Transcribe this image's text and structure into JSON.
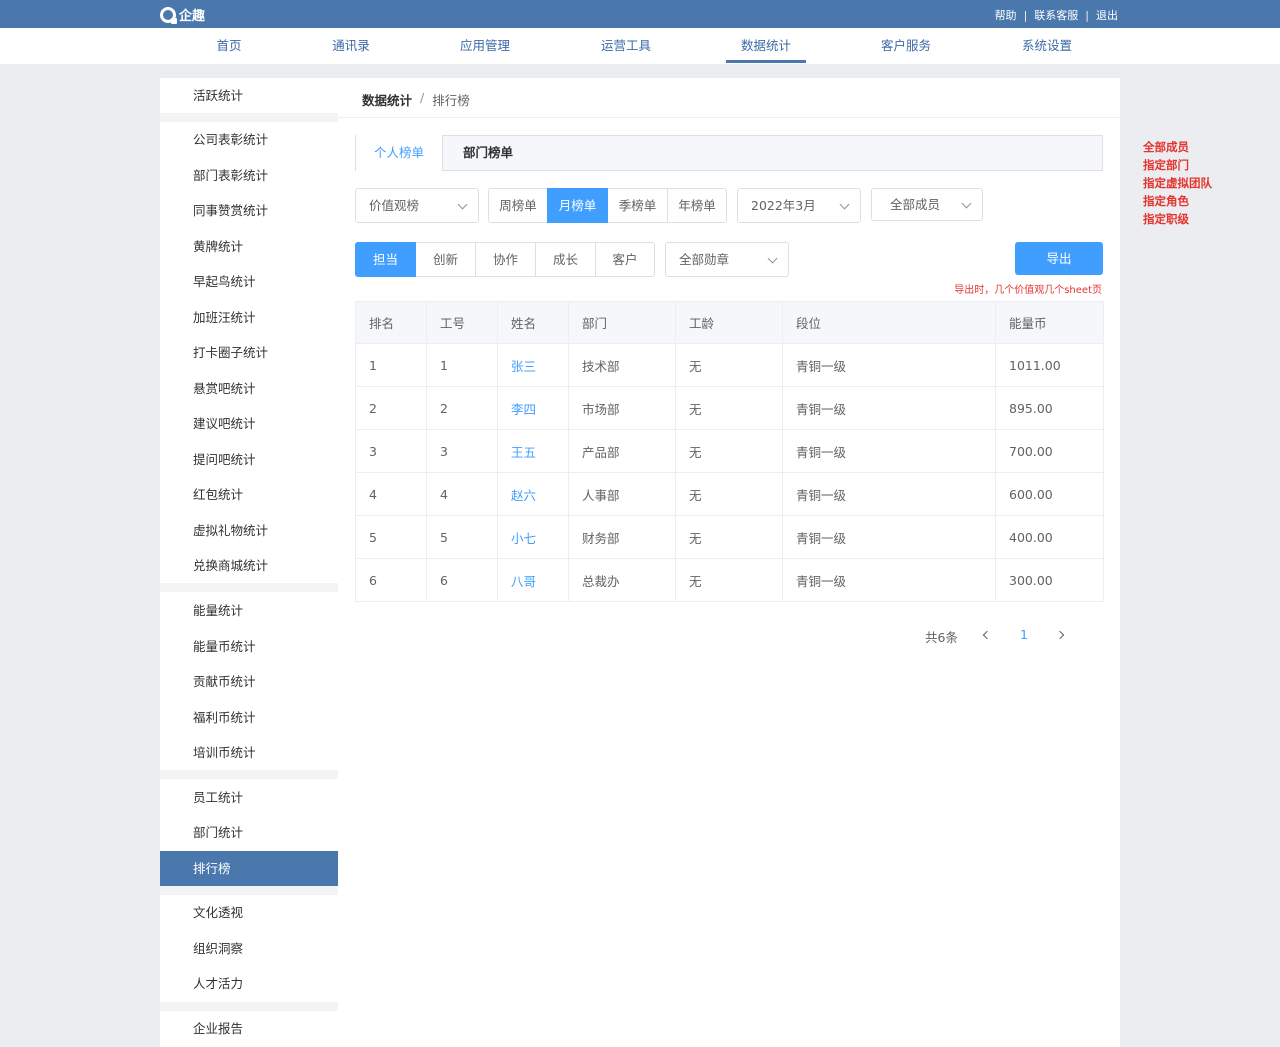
{
  "app": {
    "logo_text": "企趣"
  },
  "top_links": [
    "帮助",
    "联系客服",
    "退出"
  ],
  "main_nav": [
    "首页",
    "通讯录",
    "应用管理",
    "运营工具",
    "数据统计",
    "客户服务",
    "系统设置"
  ],
  "main_nav_active": "数据统计",
  "sidebar": {
    "groups": [
      [
        "活跃统计"
      ],
      [
        "公司表彰统计",
        "部门表彰统计",
        "同事赞赏统计",
        "黄牌统计",
        "早起鸟统计",
        "加班汪统计",
        "打卡圈子统计",
        "悬赏吧统计",
        "建议吧统计",
        "提问吧统计",
        "红包统计",
        "虚拟礼物统计",
        "兑换商城统计"
      ],
      [
        "能量统计",
        "能量币统计",
        "贡献币统计",
        "福利币统计",
        "培训币统计"
      ],
      [
        "员工统计",
        "部门统计",
        "排行榜"
      ],
      [
        "文化透视",
        "组织洞察",
        "人才活力"
      ],
      [
        "企业报告"
      ]
    ],
    "active": "排行榜"
  },
  "breadcrumb": {
    "parent": "数据统计",
    "separator": "/",
    "current": "排行榜"
  },
  "tabs": {
    "active": "个人榜单",
    "other": "部门榜单"
  },
  "filters": {
    "value_select": "价值观榜",
    "period_buttons": [
      "周榜单",
      "月榜单",
      "季榜单",
      "年榜单"
    ],
    "period_active": "月榜单",
    "month_select": "2022年3月",
    "member_select": "全部成员",
    "value_buttons": [
      "担当",
      "创新",
      "协作",
      "成长",
      "客户"
    ],
    "value_active": "担当",
    "medal_select": "全部勋章"
  },
  "export": {
    "label": "导出",
    "note": "导出时，几个价值观几个sheet页"
  },
  "table": {
    "headers": [
      "排名",
      "工号",
      "姓名",
      "部门",
      "工龄",
      "段位",
      "能量币"
    ],
    "rows": [
      [
        "1",
        "1",
        "张三",
        "技术部",
        "无",
        "青铜一级",
        "1011.00"
      ],
      [
        "2",
        "2",
        "李四",
        "市场部",
        "无",
        "青铜一级",
        "895.00"
      ],
      [
        "3",
        "3",
        "王五",
        "产品部",
        "无",
        "青铜一级",
        "700.00"
      ],
      [
        "4",
        "4",
        "赵六",
        "人事部",
        "无",
        "青铜一级",
        "600.00"
      ],
      [
        "5",
        "5",
        "小七",
        "财务部",
        "无",
        "青铜一级",
        "400.00"
      ],
      [
        "6",
        "6",
        "八哥",
        "总裁办",
        "无",
        "青铜一级",
        "300.00"
      ]
    ]
  },
  "pagination": {
    "total": "共6条",
    "current_page": "1"
  },
  "side_notes": [
    "全部成员",
    "指定部门",
    "指定虚拟团队",
    "指定角色",
    "指定职级"
  ],
  "colors": {
    "topbar": "#4a78ad",
    "accent": "#409eff",
    "note": "#e5342e"
  }
}
